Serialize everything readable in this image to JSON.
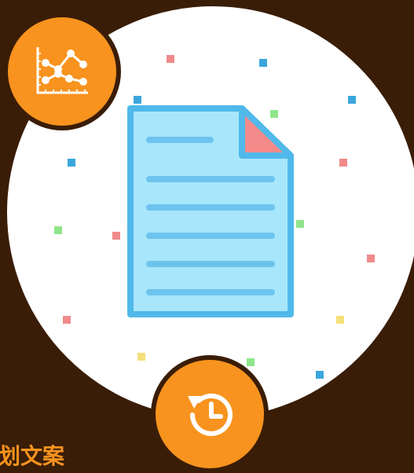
{
  "bottom_text": "划文案",
  "icons": [
    "chart-icon",
    "document-icon",
    "history-icon"
  ],
  "colors": {
    "background": "#3a1d07",
    "circle": "#ffffff",
    "accent": "#f7931e",
    "document_fill": "#a8e6fb",
    "document_stroke": "#50b9ea",
    "corner_fold": "#f58a8a"
  }
}
